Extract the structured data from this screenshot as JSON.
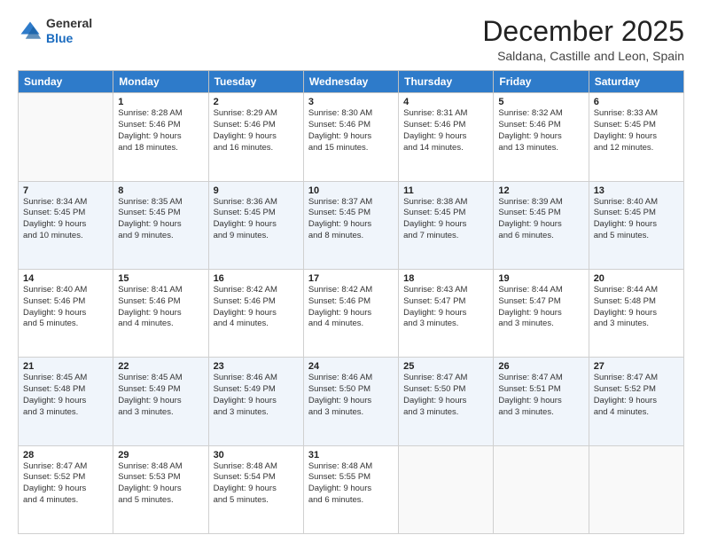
{
  "logo": {
    "general": "General",
    "blue": "Blue"
  },
  "header": {
    "month": "December 2025",
    "location": "Saldana, Castille and Leon, Spain"
  },
  "weekdays": [
    "Sunday",
    "Monday",
    "Tuesday",
    "Wednesday",
    "Thursday",
    "Friday",
    "Saturday"
  ],
  "weeks": [
    [
      {
        "day": "",
        "info": ""
      },
      {
        "day": "1",
        "info": "Sunrise: 8:28 AM\nSunset: 5:46 PM\nDaylight: 9 hours\nand 18 minutes."
      },
      {
        "day": "2",
        "info": "Sunrise: 8:29 AM\nSunset: 5:46 PM\nDaylight: 9 hours\nand 16 minutes."
      },
      {
        "day": "3",
        "info": "Sunrise: 8:30 AM\nSunset: 5:46 PM\nDaylight: 9 hours\nand 15 minutes."
      },
      {
        "day": "4",
        "info": "Sunrise: 8:31 AM\nSunset: 5:46 PM\nDaylight: 9 hours\nand 14 minutes."
      },
      {
        "day": "5",
        "info": "Sunrise: 8:32 AM\nSunset: 5:46 PM\nDaylight: 9 hours\nand 13 minutes."
      },
      {
        "day": "6",
        "info": "Sunrise: 8:33 AM\nSunset: 5:45 PM\nDaylight: 9 hours\nand 12 minutes."
      }
    ],
    [
      {
        "day": "7",
        "info": "Sunrise: 8:34 AM\nSunset: 5:45 PM\nDaylight: 9 hours\nand 10 minutes."
      },
      {
        "day": "8",
        "info": "Sunrise: 8:35 AM\nSunset: 5:45 PM\nDaylight: 9 hours\nand 9 minutes."
      },
      {
        "day": "9",
        "info": "Sunrise: 8:36 AM\nSunset: 5:45 PM\nDaylight: 9 hours\nand 9 minutes."
      },
      {
        "day": "10",
        "info": "Sunrise: 8:37 AM\nSunset: 5:45 PM\nDaylight: 9 hours\nand 8 minutes."
      },
      {
        "day": "11",
        "info": "Sunrise: 8:38 AM\nSunset: 5:45 PM\nDaylight: 9 hours\nand 7 minutes."
      },
      {
        "day": "12",
        "info": "Sunrise: 8:39 AM\nSunset: 5:45 PM\nDaylight: 9 hours\nand 6 minutes."
      },
      {
        "day": "13",
        "info": "Sunrise: 8:40 AM\nSunset: 5:45 PM\nDaylight: 9 hours\nand 5 minutes."
      }
    ],
    [
      {
        "day": "14",
        "info": "Sunrise: 8:40 AM\nSunset: 5:46 PM\nDaylight: 9 hours\nand 5 minutes."
      },
      {
        "day": "15",
        "info": "Sunrise: 8:41 AM\nSunset: 5:46 PM\nDaylight: 9 hours\nand 4 minutes."
      },
      {
        "day": "16",
        "info": "Sunrise: 8:42 AM\nSunset: 5:46 PM\nDaylight: 9 hours\nand 4 minutes."
      },
      {
        "day": "17",
        "info": "Sunrise: 8:42 AM\nSunset: 5:46 PM\nDaylight: 9 hours\nand 4 minutes."
      },
      {
        "day": "18",
        "info": "Sunrise: 8:43 AM\nSunset: 5:47 PM\nDaylight: 9 hours\nand 3 minutes."
      },
      {
        "day": "19",
        "info": "Sunrise: 8:44 AM\nSunset: 5:47 PM\nDaylight: 9 hours\nand 3 minutes."
      },
      {
        "day": "20",
        "info": "Sunrise: 8:44 AM\nSunset: 5:48 PM\nDaylight: 9 hours\nand 3 minutes."
      }
    ],
    [
      {
        "day": "21",
        "info": "Sunrise: 8:45 AM\nSunset: 5:48 PM\nDaylight: 9 hours\nand 3 minutes."
      },
      {
        "day": "22",
        "info": "Sunrise: 8:45 AM\nSunset: 5:49 PM\nDaylight: 9 hours\nand 3 minutes."
      },
      {
        "day": "23",
        "info": "Sunrise: 8:46 AM\nSunset: 5:49 PM\nDaylight: 9 hours\nand 3 minutes."
      },
      {
        "day": "24",
        "info": "Sunrise: 8:46 AM\nSunset: 5:50 PM\nDaylight: 9 hours\nand 3 minutes."
      },
      {
        "day": "25",
        "info": "Sunrise: 8:47 AM\nSunset: 5:50 PM\nDaylight: 9 hours\nand 3 minutes."
      },
      {
        "day": "26",
        "info": "Sunrise: 8:47 AM\nSunset: 5:51 PM\nDaylight: 9 hours\nand 3 minutes."
      },
      {
        "day": "27",
        "info": "Sunrise: 8:47 AM\nSunset: 5:52 PM\nDaylight: 9 hours\nand 4 minutes."
      }
    ],
    [
      {
        "day": "28",
        "info": "Sunrise: 8:47 AM\nSunset: 5:52 PM\nDaylight: 9 hours\nand 4 minutes."
      },
      {
        "day": "29",
        "info": "Sunrise: 8:48 AM\nSunset: 5:53 PM\nDaylight: 9 hours\nand 5 minutes."
      },
      {
        "day": "30",
        "info": "Sunrise: 8:48 AM\nSunset: 5:54 PM\nDaylight: 9 hours\nand 5 minutes."
      },
      {
        "day": "31",
        "info": "Sunrise: 8:48 AM\nSunset: 5:55 PM\nDaylight: 9 hours\nand 6 minutes."
      },
      {
        "day": "",
        "info": ""
      },
      {
        "day": "",
        "info": ""
      },
      {
        "day": "",
        "info": ""
      }
    ]
  ]
}
